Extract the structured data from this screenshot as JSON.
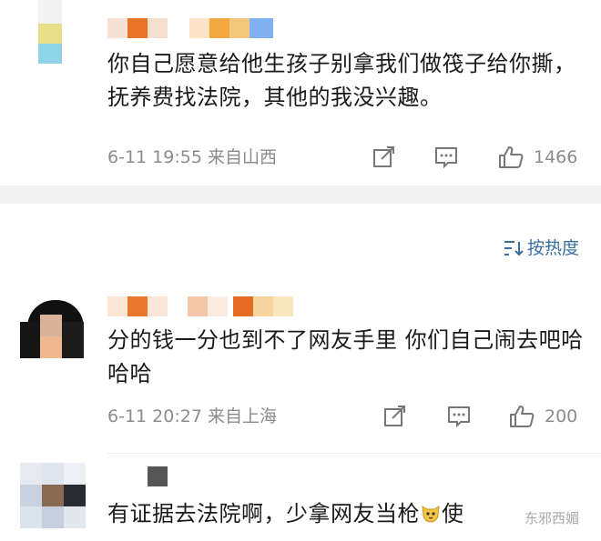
{
  "comments": [
    {
      "text": "你自己愿意给他生孩子别拿我们做筏子给你撕，抚养费找法院，其他的我没兴趣。",
      "time": "6-11 19:55",
      "location": "来自山西",
      "likes": "1466",
      "icons": [
        "share-icon",
        "comment-icon",
        "like-icon"
      ]
    },
    {
      "text": "分的钱一分也到不了网友手里 你们自己闹去吧哈哈哈",
      "time": "6-11 20:27",
      "location": "来自上海",
      "likes": "200",
      "icons": [
        "share-icon",
        "comment-icon",
        "like-icon"
      ]
    },
    {
      "text_before_emoji": "有证据去法院啊，少拿网友当枪",
      "emoji": "cat-face-emoji",
      "text_after_emoji": "使"
    }
  ],
  "sort": {
    "label": "按热度",
    "icon": "sort-icon"
  },
  "watermark": "东邪西媚",
  "colors": {
    "link": "#3a6e9e",
    "meta": "#8c8c8c",
    "divider": "#f2f2f2"
  }
}
